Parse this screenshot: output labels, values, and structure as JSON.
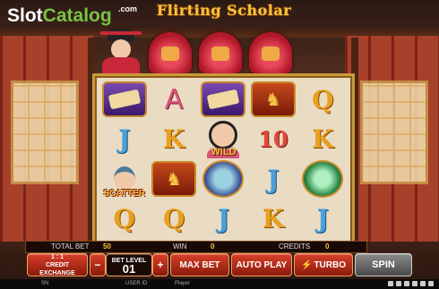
{
  "watermark": {
    "slot": "Slot",
    "catalog": "Catalog",
    "com": ".com"
  },
  "game": {
    "title": "Flirting Scholar"
  },
  "reels": {
    "rows": [
      [
        "scroll",
        "A",
        "scroll",
        "horse",
        "Q"
      ],
      [
        "J",
        "K",
        "WILD",
        "10",
        "K"
      ],
      [
        "SCATTER",
        "horse",
        "moth",
        "J",
        "jade"
      ],
      [
        "Q",
        "Q",
        "J",
        "K",
        "J"
      ]
    ],
    "wild_label": "WILD",
    "scatter_label": "SCATTER"
  },
  "info": {
    "total_bet_label": "TOTAL BET",
    "total_bet_value": "50",
    "win_label": "WIN",
    "win_value": "0",
    "credits_label": "CREDITS",
    "credits_value": "0"
  },
  "controls": {
    "credit_ratio": "1 : 1",
    "credit_exchange": "CREDIT EXCHANGE",
    "minus": "−",
    "bet_level_label": "BET LEVEL",
    "bet_level_value": "01",
    "plus": "+",
    "max_bet": "MAX BET",
    "auto_play": "AUTO PLAY",
    "turbo": "TURBO",
    "spin": "SPIN"
  },
  "footer": {
    "sn_label": "SN",
    "user_id_label": "USER ID",
    "player": "Player"
  },
  "colors": {
    "accent_gold": "#f5c542",
    "button_red": "#d8402a",
    "watermark_green": "#7ac143"
  }
}
